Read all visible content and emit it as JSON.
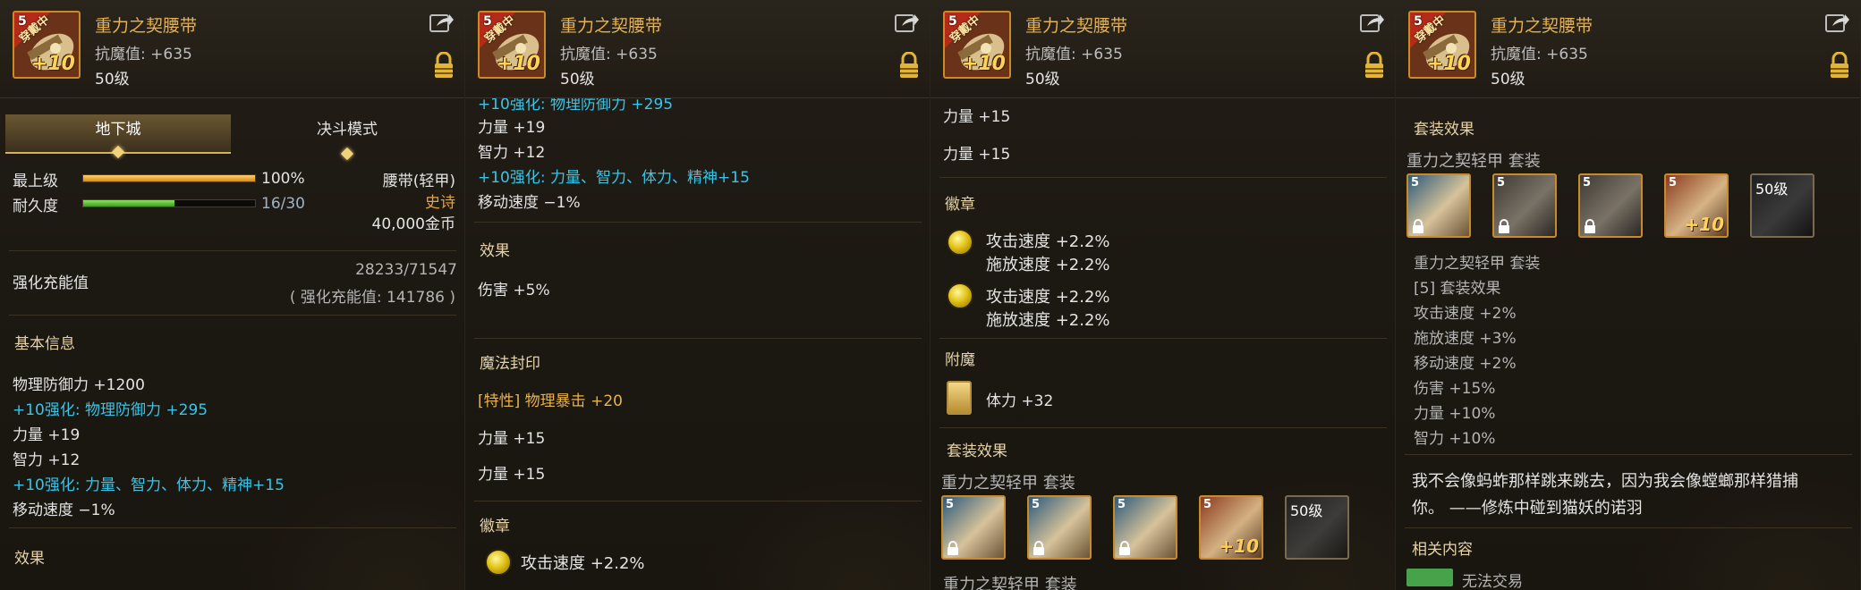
{
  "item": {
    "name": "重力之契腰带",
    "resist": "抗魔值: +635",
    "level": "50级",
    "wearing_tag": "穿戴中",
    "upgrade_badge": "+10"
  },
  "panel1": {
    "tabs": [
      "地下城",
      "决斗模式"
    ],
    "grade_label": "最上级",
    "grade_pct": "100%",
    "grade_fraction": 1.0,
    "durability_label": "耐久度",
    "durability_value": "16/30",
    "durability_fraction": 0.533,
    "item_type": "腰带(轻甲)",
    "rarity": "史诗",
    "price": "40,000金币",
    "reinforce_label": "强化充能值",
    "reinforce_value": "28233/71547",
    "reinforce_total": "( 强化充能值: 141786 )",
    "basic_info_title": "基本信息",
    "stats": [
      {
        "text": "物理防御力 +1200",
        "style": "white"
      },
      {
        "text": "+10强化: 物理防御力 +295",
        "style": "cyan"
      },
      {
        "text": "力量 +19",
        "style": "white"
      },
      {
        "text": "智力 +12",
        "style": "white"
      },
      {
        "text": "+10强化: 力量、智力、体力、精神+15",
        "style": "cyan"
      },
      {
        "text": "移动速度 −1%",
        "style": "white"
      }
    ],
    "effect_title": "效果"
  },
  "panel2": {
    "cut_line": "+10强化: 物理防御力 +295",
    "stats": [
      {
        "text": "力量 +19",
        "style": "white"
      },
      {
        "text": "智力 +12",
        "style": "white"
      },
      {
        "text": "+10强化: 力量、智力、体力、精神+15",
        "style": "cyan"
      },
      {
        "text": "移动速度 −1%",
        "style": "white"
      }
    ],
    "effect_title": "效果",
    "effect_line": "伤害 +5%",
    "seal_title": "魔法封印",
    "seal_tag": "[特性] 物理暴击 +20",
    "seal_lines": [
      "力量 +15",
      "力量 +15"
    ],
    "emblem_title": "徽章",
    "emblem_line": "攻击速度 +2.2%"
  },
  "panel3": {
    "lines_top": [
      "力量 +15",
      "力量 +15"
    ],
    "emblem_title": "徽章",
    "emblems": [
      {
        "l1": "攻击速度 +2.2%",
        "l2": "施放速度 +2.2%"
      },
      {
        "l1": "攻击速度 +2.2%",
        "l2": "施放速度 +2.2%"
      }
    ],
    "enchant_title": "附魔",
    "enchant_line": "体力 +32",
    "set_title": "套装效果",
    "set_name": "重力之契轻甲 套装",
    "set_level_label": "50级",
    "cut_line": "重力之契轻甲 套装"
  },
  "panel4": {
    "set_title": "套装效果",
    "set_name": "重力之契轻甲 套装",
    "set_level_label": "50级",
    "set_sub": "重力之契轻甲 套装",
    "set_bonus_title": "[5] 套装效果",
    "set_bonus": [
      "攻击速度 +2%",
      "施放速度 +3%",
      "移动速度 +2%",
      "伤害 +15%",
      "力量 +10%",
      "智力 +10%"
    ],
    "flavor": [
      "我不会像蚂蚱那样跳来跳去，因为我会像螳螂那样猎捕",
      "你。 ——修炼中碰到猫妖的诺羽"
    ],
    "related_title": "相关内容",
    "related_cut": "无法交易"
  },
  "colors": {
    "gold": "#e9b24a",
    "cyan": "#37c6ea",
    "rarity": "#e9a23a"
  }
}
